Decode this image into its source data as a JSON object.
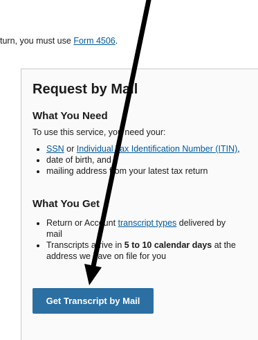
{
  "top_text": {
    "prefix": "turn, you must use",
    "link": "Form 4506"
  },
  "card": {
    "title": "Request by Mail",
    "need": {
      "heading": "What You Need",
      "intro": "To use this service, you need your:",
      "items": [
        {
          "link1": "SSN",
          "mid": " or ",
          "link2": "Individual Tax Identification Number (ITIN)",
          "suffix": ","
        },
        {
          "text": "date of birth, and"
        },
        {
          "text": "mailing address from your latest tax return"
        }
      ]
    },
    "get": {
      "heading": "What You Get",
      "items": [
        {
          "prefix": "Return or Account ",
          "link": "transcript types",
          "suffix": " delivered by mail"
        },
        {
          "prefix": "Transcripts arrive in ",
          "bold": "5 to 10 calendar days",
          "suffix": " at the address we have on file for you"
        }
      ]
    },
    "button_label": "Get Transcript by Mail"
  },
  "annotation": {
    "arrow_color": "#000000",
    "arrow_icon": "arrow-down-icon"
  }
}
